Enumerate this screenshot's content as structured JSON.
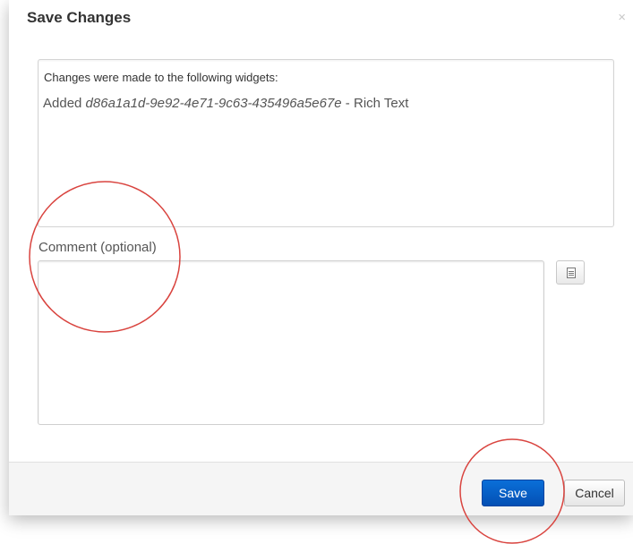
{
  "dialog": {
    "title": "Save Changes",
    "close_glyph": "×",
    "changes": {
      "intro": "Changes were made to the following widgets:",
      "action": "Added",
      "widget_id": "d86a1a1d-9e92-4e71-9c63-435496a5e67e",
      "separator": " - ",
      "widget_type": "Rich Text"
    },
    "comment": {
      "label": "Comment (optional)",
      "value": "",
      "placeholder": ""
    },
    "template_button_icon": "document-icon",
    "footer": {
      "save_label": "Save",
      "cancel_label": "Cancel"
    }
  },
  "colors": {
    "primary_button": "#0a6fd8",
    "annotation": "#d9443f",
    "footer_bg": "#f5f5f5"
  },
  "annotations": {
    "shape": "circle",
    "count": 2,
    "targets": [
      "comment-label",
      "save-button"
    ]
  }
}
